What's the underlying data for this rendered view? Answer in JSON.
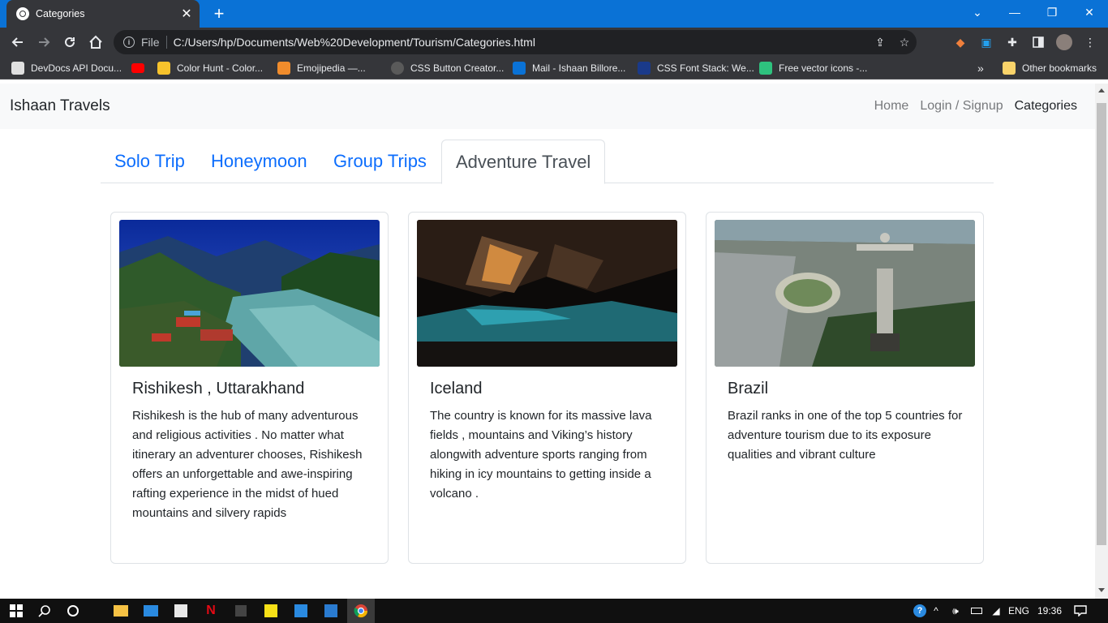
{
  "browser": {
    "tab_title": "Categories",
    "new_tab": "+",
    "close_tab": "✕",
    "window_controls": {
      "dropdown": "⌄",
      "minimize": "—",
      "restore": "❐",
      "close": "✕"
    },
    "omnibox": {
      "protocol": "File",
      "url": "C:/Users/hp/Documents/Web%20Development/Tourism/Categories.html"
    },
    "bookmarks": [
      {
        "label": "DevDocs API Docu..."
      },
      {
        "label": ""
      },
      {
        "label": "Color Hunt - Color..."
      },
      {
        "label": "Emojipedia —..."
      },
      {
        "label": "CSS Button Creator..."
      },
      {
        "label": "Mail - Ishaan Billore..."
      },
      {
        "label": "CSS Font Stack: We..."
      },
      {
        "label": "Free vector icons -..."
      }
    ],
    "bookmarks_overflow": "»",
    "other_bookmarks": "Other bookmarks"
  },
  "site": {
    "brand": "Ishaan Travels",
    "nav": {
      "home": "Home",
      "login": "Login / Signup",
      "categories": "Categories"
    },
    "tabs": [
      {
        "label": "Solo Trip"
      },
      {
        "label": "Honeymoon"
      },
      {
        "label": "Group Trips"
      },
      {
        "label": "Adventure Travel"
      }
    ],
    "cards": [
      {
        "title": "Rishikesh , Uttarakhand",
        "text": "Rishikesh is the hub of many adventurous and religious activities . No matter what itinerary an adventurer chooses, Rishikesh offers an unforgettable and awe-inspiring rafting experience in the midst of hued mountains and silvery rapids"
      },
      {
        "title": "Iceland",
        "text": "The country is known for its massive lava fields , mountains and Viking’s history alongwith adventure sports ranging from hiking in icy mountains to getting inside a volcano ."
      },
      {
        "title": "Brazil",
        "text": "Brazil ranks in one of the top 5 countries for adventure tourism due to its exposure qualities and vibrant culture"
      }
    ]
  },
  "taskbar": {
    "language": "ENG",
    "time": "19:36"
  }
}
